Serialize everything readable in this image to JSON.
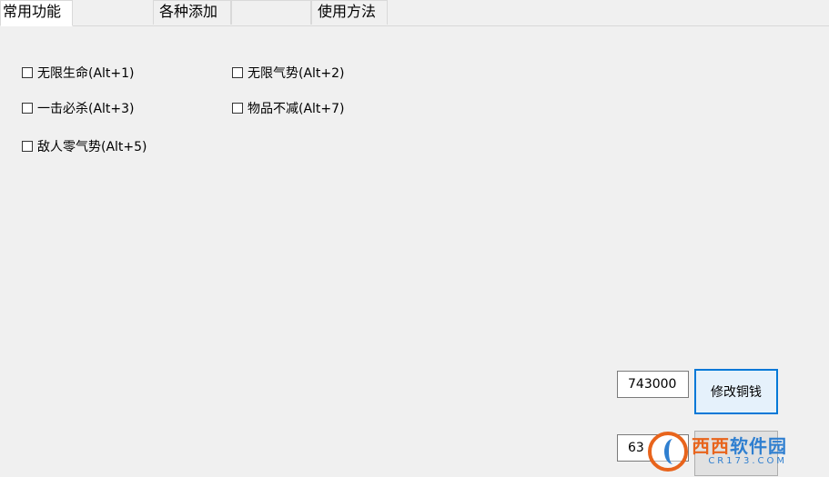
{
  "tabs": [
    {
      "label": "常用功能",
      "active": true
    },
    {
      "label": "各种添加",
      "active": false
    },
    {
      "label": "",
      "active": false
    },
    {
      "label": "使用方法",
      "active": false
    }
  ],
  "checkboxes": [
    {
      "label": "无限生命(Alt+1)",
      "checked": false
    },
    {
      "label": "无限气势(Alt+2)",
      "checked": false
    },
    {
      "label": "一击必杀(Alt+3)",
      "checked": false
    },
    {
      "label": "物品不减(Alt+7)",
      "checked": false
    },
    {
      "label": "敌人零气势(Alt+5)",
      "checked": false
    }
  ],
  "money": {
    "value": "743000",
    "button_label": "修改铜钱"
  },
  "second": {
    "value": "63",
    "button_label": ""
  },
  "watermark": {
    "main_orange": "西西",
    "main_blue": "软件园",
    "sub": "CR173.COM"
  },
  "colors": {
    "focus_border": "#0078d7",
    "watermark_orange": "#e8641c",
    "watermark_blue": "#2f7fd0"
  }
}
